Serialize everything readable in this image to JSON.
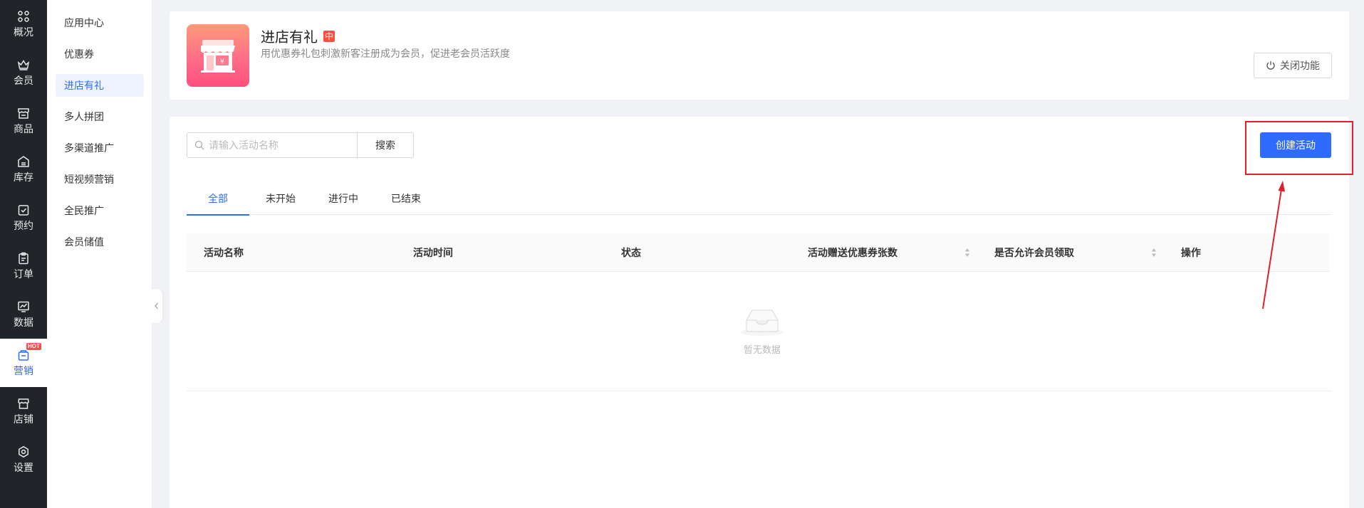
{
  "nav": {
    "items": [
      {
        "label": "概况",
        "icon": "grid-icon"
      },
      {
        "label": "会员",
        "icon": "crown-icon"
      },
      {
        "label": "商品",
        "icon": "store-icon"
      },
      {
        "label": "库存",
        "icon": "warehouse-icon"
      },
      {
        "label": "预约",
        "icon": "calendar-check-icon"
      },
      {
        "label": "订单",
        "icon": "clipboard-icon"
      },
      {
        "label": "数据",
        "icon": "chart-icon"
      },
      {
        "label": "营销",
        "icon": "marketing-icon",
        "active": true,
        "badge": "HOT"
      },
      {
        "label": "店铺",
        "icon": "shop-icon"
      },
      {
        "label": "设置",
        "icon": "settings-icon"
      }
    ]
  },
  "subnav": {
    "items": [
      {
        "label": "应用中心"
      },
      {
        "label": "优惠券"
      },
      {
        "label": "进店有礼",
        "active": true
      },
      {
        "label": "多人拼团"
      },
      {
        "label": "多渠道推广"
      },
      {
        "label": "短视频营销"
      },
      {
        "label": "全民推广"
      },
      {
        "label": "会员储值"
      }
    ]
  },
  "header": {
    "title": "进店有礼",
    "badge": "中",
    "desc": "用优惠券礼包刺激新客注册成为会员，促进老会员活跃度",
    "close_label": "关闭功能"
  },
  "search": {
    "placeholder": "请输入活动名称",
    "value": "",
    "button_label": "搜索"
  },
  "create_label": "创建活动",
  "tabs": [
    {
      "label": "全部",
      "active": true
    },
    {
      "label": "未开始"
    },
    {
      "label": "进行中"
    },
    {
      "label": "已结束"
    }
  ],
  "table": {
    "columns": [
      {
        "label": "活动名称"
      },
      {
        "label": "活动时间"
      },
      {
        "label": "状态"
      },
      {
        "label": "活动赠送优惠券张数",
        "sortable": true
      },
      {
        "label": "是否允许会员领取",
        "sortable": true
      },
      {
        "label": "操作"
      }
    ],
    "rows": [],
    "empty_text": "暂无数据"
  },
  "colors": {
    "accent": "#2f6bff",
    "nav_bg": "#212429",
    "annotation": "#e0202a"
  }
}
